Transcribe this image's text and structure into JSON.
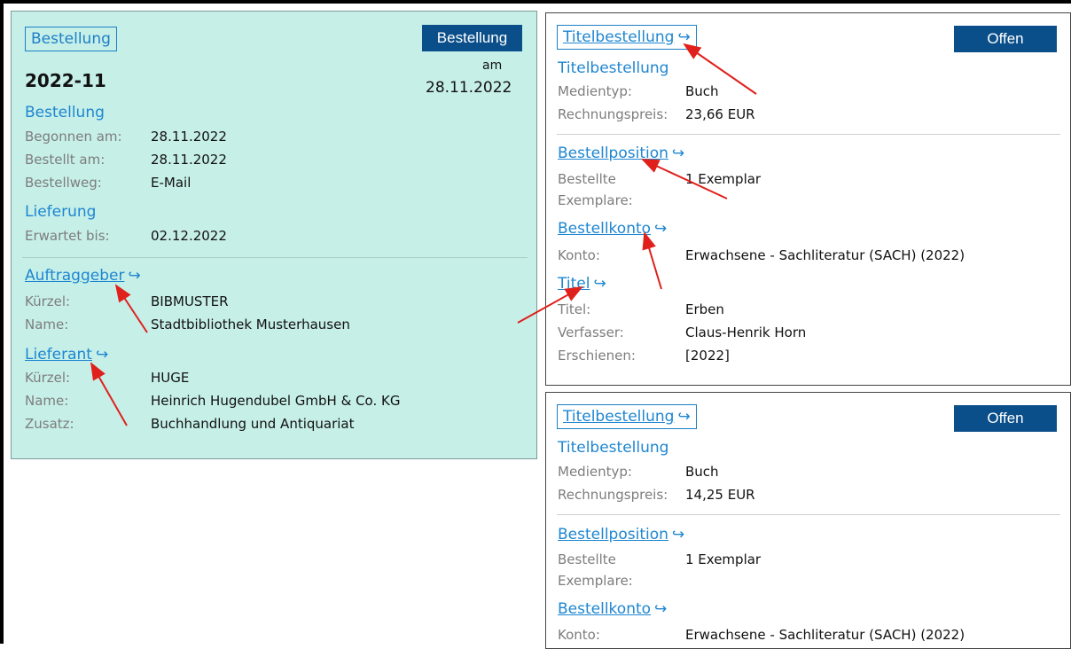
{
  "order": {
    "tag": "Bestellung",
    "status": "Bestellung",
    "number": "2022-11",
    "date_prefix": "am",
    "date": "28.11.2022",
    "section_order": "Bestellung",
    "begun_label": "Begonnen am:",
    "begun_value": "28.11.2022",
    "ordered_label": "Bestellt am:",
    "ordered_value": "28.11.2022",
    "way_label": "Bestellweg:",
    "way_value": "E-Mail",
    "section_delivery": "Lieferung",
    "expected_label": "Erwartet bis:",
    "expected_value": "02.12.2022",
    "client_link": "Auftraggeber",
    "client_short_label": "Kürzel:",
    "client_short_value": "BIBMUSTER",
    "client_name_label": "Name:",
    "client_name_value": "Stadtbibliothek Musterhausen",
    "supplier_link": "Lieferant",
    "supplier_short_label": "Kürzel:",
    "supplier_short_value": "HUGE",
    "supplier_name_label": "Name:",
    "supplier_name_value": "Heinrich Hugendubel GmbH & Co. KG",
    "supplier_extra_label": "Zusatz:",
    "supplier_extra_value": "Buchhandlung und Antiquariat"
  },
  "cards": [
    {
      "link": "Titelbestellung",
      "status": "Offen",
      "section": "Titelbestellung",
      "media_label": "Medientyp:",
      "media_value": "Buch",
      "price_label": "Rechnungspreis:",
      "price_value": "23,66 EUR",
      "position_link": "Bestellposition",
      "copies_label_1": "Bestellte",
      "copies_label_2": "Exemplare:",
      "copies_value": "1 Exemplar",
      "account_link": "Bestellkonto",
      "account_label": "Konto:",
      "account_value": "Erwachsene - Sachliteratur (SACH) (2022)",
      "title_link": "Titel",
      "title_label": "Titel:",
      "title_value": "Erben",
      "author_label": "Verfasser:",
      "author_value": "Claus-Henrik Horn",
      "published_label": "Erschienen:",
      "published_value": "[2022]"
    },
    {
      "link": "Titelbestellung",
      "status": "Offen",
      "section": "Titelbestellung",
      "media_label": "Medientyp:",
      "media_value": "Buch",
      "price_label": "Rechnungspreis:",
      "price_value": "14,25 EUR",
      "position_link": "Bestellposition",
      "copies_label_1": "Bestellte",
      "copies_label_2": "Exemplare:",
      "copies_value": "1 Exemplar",
      "account_link": "Bestellkonto",
      "account_label": "Konto:",
      "account_value": "Erwachsene - Sachliteratur (SACH) (2022)"
    }
  ],
  "link_arrow_glyph": "↪",
  "colors": {
    "order_panel_bg": "#c6efe8",
    "accent_blue": "#1e86d0",
    "status_button": "#0b4f8a",
    "annotation_red": "#e0201b"
  }
}
